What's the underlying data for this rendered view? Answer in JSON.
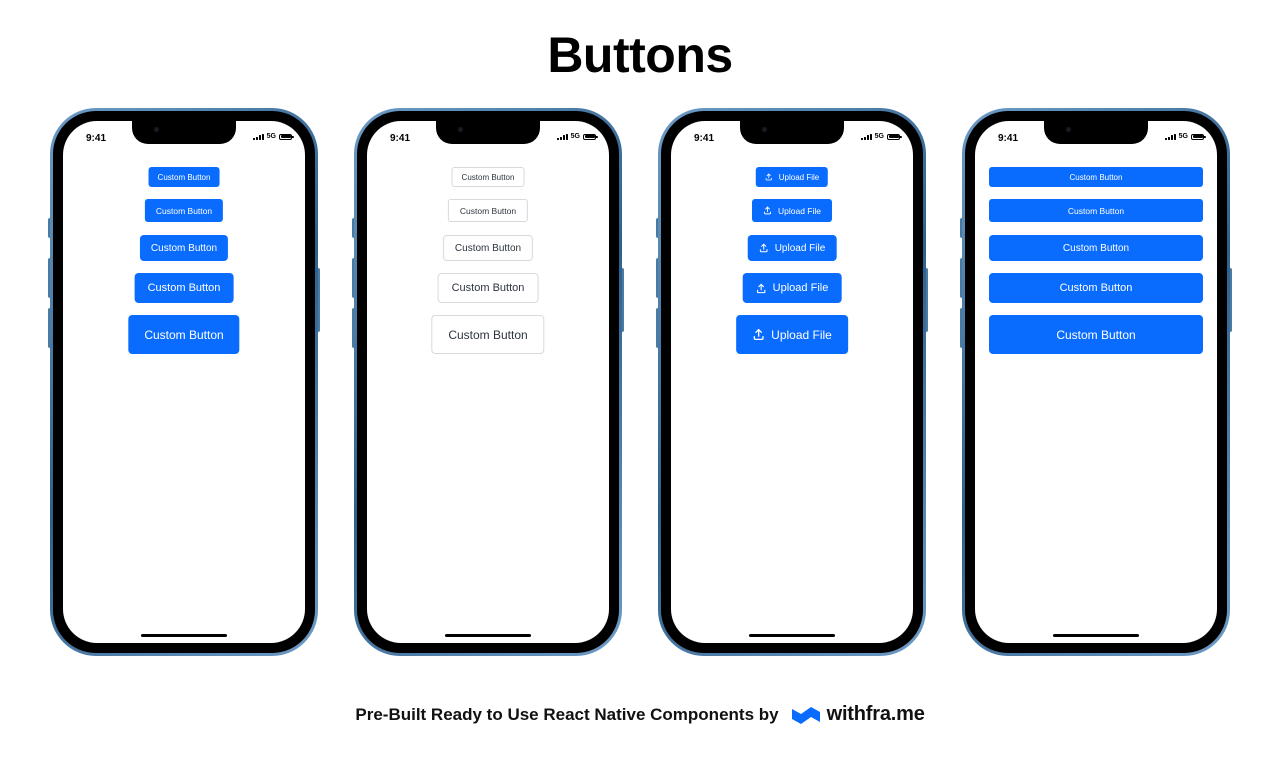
{
  "page": {
    "title": "Buttons",
    "footer_text": "Pre-Built Ready to Use React Native Components by",
    "brand_name": "withfra.me",
    "brand_color": "#0a6cff"
  },
  "colors": {
    "primary": "#0a6cff",
    "outline_border": "#d6d9de",
    "outline_text": "#2e3440",
    "phone_frame": "#4a7aa6"
  },
  "phones": [
    {
      "variant": "solid",
      "status": {
        "time": "9:41",
        "network": "5G"
      },
      "buttons": [
        {
          "label": "Custom Button",
          "size": "xs"
        },
        {
          "label": "Custom Button",
          "size": "sm"
        },
        {
          "label": "Custom Button",
          "size": "md"
        },
        {
          "label": "Custom Button",
          "size": "lg"
        },
        {
          "label": "Custom Button",
          "size": "xl"
        }
      ]
    },
    {
      "variant": "outline",
      "status": {
        "time": "9:41",
        "network": "5G"
      },
      "buttons": [
        {
          "label": "Custom Button",
          "size": "xs"
        },
        {
          "label": "Custom Button",
          "size": "sm"
        },
        {
          "label": "Custom Button",
          "size": "md"
        },
        {
          "label": "Custom Button",
          "size": "lg"
        },
        {
          "label": "Custom Button",
          "size": "xl"
        }
      ]
    },
    {
      "variant": "solid-with-icon",
      "status": {
        "time": "9:41",
        "network": "5G"
      },
      "buttons": [
        {
          "label": "Upload File",
          "size": "xs",
          "icon": "upload-icon"
        },
        {
          "label": "Upload File",
          "size": "sm",
          "icon": "upload-icon"
        },
        {
          "label": "Upload File",
          "size": "md",
          "icon": "upload-icon"
        },
        {
          "label": "Upload File",
          "size": "lg",
          "icon": "upload-icon"
        },
        {
          "label": "Upload File",
          "size": "xl",
          "icon": "upload-icon"
        }
      ]
    },
    {
      "variant": "solid-full-width",
      "status": {
        "time": "9:41",
        "network": "5G"
      },
      "buttons": [
        {
          "label": "Custom Button",
          "size": "xs"
        },
        {
          "label": "Custom Button",
          "size": "sm"
        },
        {
          "label": "Custom Button",
          "size": "md"
        },
        {
          "label": "Custom Button",
          "size": "lg"
        },
        {
          "label": "Custom Button",
          "size": "xl"
        }
      ]
    }
  ]
}
